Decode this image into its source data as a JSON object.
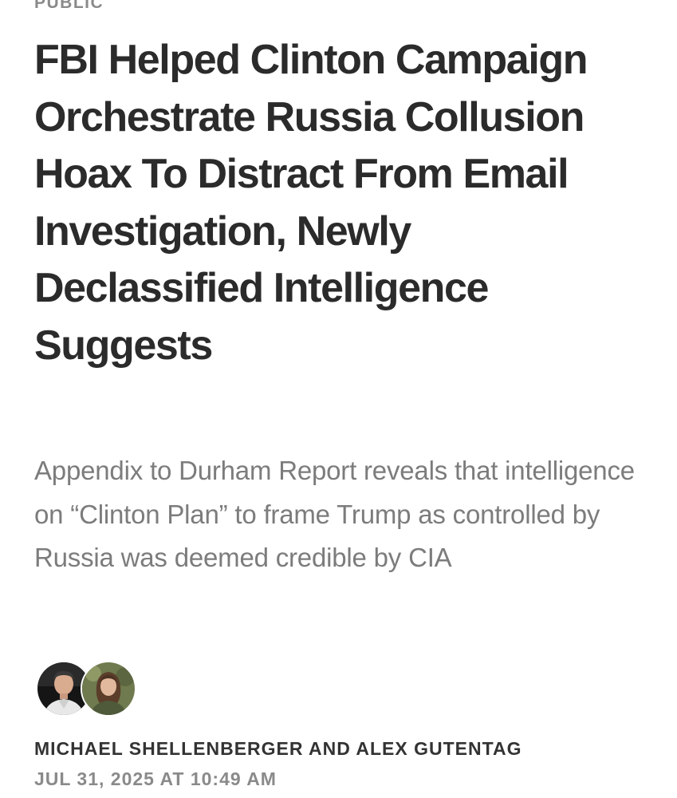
{
  "section_label": "PUBLIC",
  "headline": "FBI Helped Clinton Campaign Orchestrate Russia Collusion Hoax To Distract From Email Investigation, Newly Declassified Intelligence Suggests",
  "subtitle": "Appendix to Durham Report reveals that intelligence on “Clinton Plan” to frame Trump as controlled by Russia was deemed credible by CIA",
  "byline": {
    "authors": "MICHAEL SHELLENBERGER AND ALEX GUTENTAG",
    "date": "JUL 31, 2025 AT 10:49 AM"
  },
  "avatars": [
    {
      "icon": "author-photo-avatar",
      "background": "#1a1a1a"
    },
    {
      "icon": "author-photo-avatar",
      "background": "#6f7a4e"
    }
  ],
  "colors": {
    "headline": "#2b2b2b",
    "subtitle": "#7c7c7c",
    "label": "#8a8a8a",
    "byline": "#333333",
    "date": "#8a8a8a"
  }
}
